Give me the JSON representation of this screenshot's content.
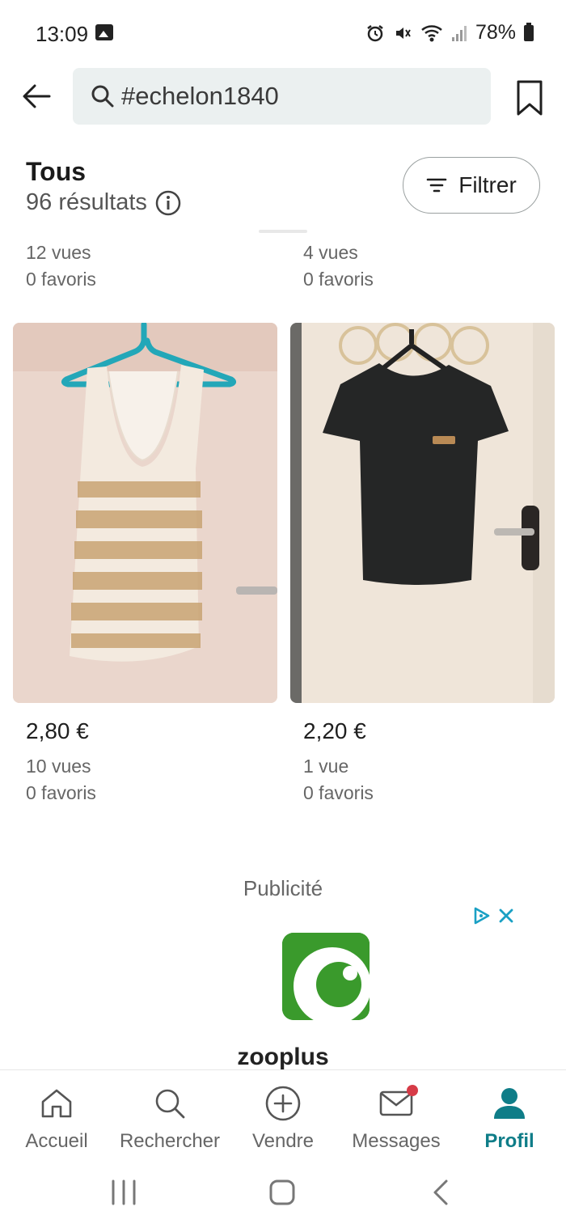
{
  "status_bar": {
    "time": "13:09",
    "battery": "78%",
    "icons": [
      "image-icon",
      "alarm-icon",
      "mute-icon",
      "wifi-icon",
      "signal-icon",
      "battery-icon"
    ]
  },
  "top_bar": {
    "search_value": "#echelon1840",
    "icons": [
      "back-arrow-icon",
      "search-icon",
      "bookmark-icon"
    ]
  },
  "results": {
    "title": "Tous",
    "count": "96 résultats",
    "filter_label": "Filtrer"
  },
  "previous_row": [
    {
      "views": "12 vues",
      "favorites": "0 favoris"
    },
    {
      "views": "4 vues",
      "favorites": "0 favoris"
    }
  ],
  "products": [
    {
      "price": "2,80 €",
      "views": "10 vues",
      "favorites": "0 favoris",
      "image": "striped-beige-lace-tank-top"
    },
    {
      "price": "2,20 €",
      "views": "1 vue",
      "favorites": "0 favoris",
      "image": "black-short-sleeve-top"
    }
  ],
  "ad": {
    "label": "Publicité",
    "brand": "zooplus",
    "brand_color": "#3a9a2c"
  },
  "bottom_nav": [
    {
      "label": "Accueil",
      "icon": "home-icon",
      "active": false
    },
    {
      "label": "Rechercher",
      "icon": "search-icon",
      "active": false
    },
    {
      "label": "Vendre",
      "icon": "plus-circle-icon",
      "active": false
    },
    {
      "label": "Messages",
      "icon": "mail-icon",
      "active": false,
      "badge": true
    },
    {
      "label": "Profil",
      "icon": "person-icon",
      "active": true
    }
  ],
  "colors": {
    "accent": "#0f7d88",
    "search_bg": "#ebf0f0",
    "badge": "#d63b47",
    "adchoices": "#1aa0c4"
  }
}
